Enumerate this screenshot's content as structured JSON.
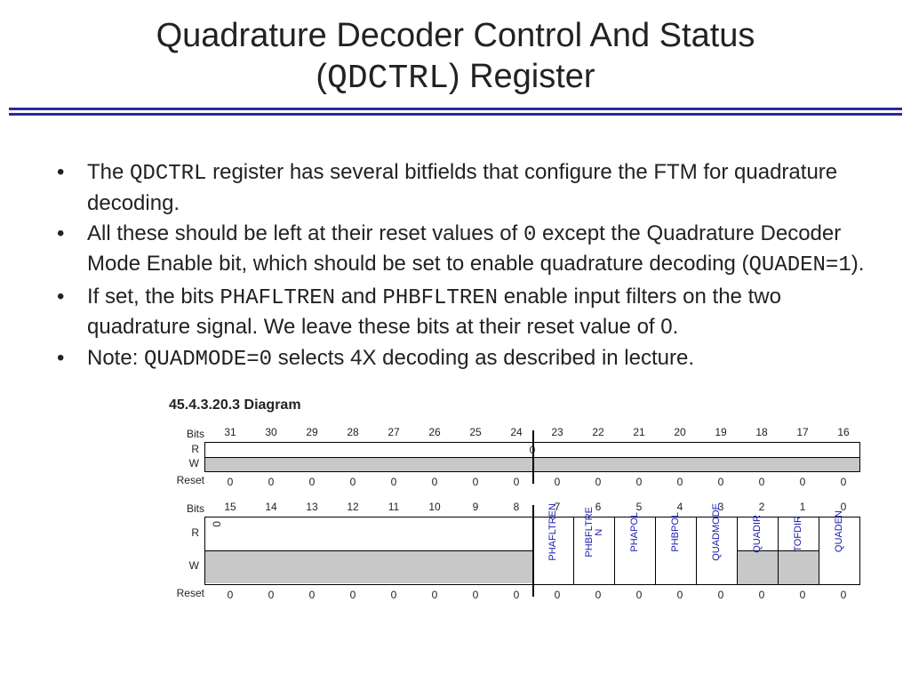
{
  "title": {
    "line1_pre": "Quadrature Decoder Control And Status",
    "line2_pre": "(",
    "line2_mono": "QDCTRL",
    "line2_post": ") Register"
  },
  "bullets": [
    {
      "parts": [
        {
          "t": "text",
          "v": "The "
        },
        {
          "t": "mono",
          "v": "QDCTRL"
        },
        {
          "t": "text",
          "v": " register has several bitfields that configure the FTM for quadrature decoding."
        }
      ]
    },
    {
      "parts": [
        {
          "t": "text",
          "v": "All these should be left at their reset values of "
        },
        {
          "t": "mono",
          "v": "0"
        },
        {
          "t": "text",
          "v": " except the Quadrature Decoder Mode Enable bit, which should be set to enable quadrature decoding ("
        },
        {
          "t": "mono",
          "v": "QUADEN=1"
        },
        {
          "t": "text",
          "v": ")."
        }
      ]
    },
    {
      "parts": [
        {
          "t": "text",
          "v": "If set, the bits "
        },
        {
          "t": "mono",
          "v": "PHAFLTREN"
        },
        {
          "t": "text",
          "v": " and "
        },
        {
          "t": "mono",
          "v": "PHBFLTREN"
        },
        {
          "t": "text",
          "v": " enable input filters on the two quadrature signal. We leave these bits at their reset value of 0."
        }
      ]
    },
    {
      "parts": [
        {
          "t": "text",
          "v": "Note: "
        },
        {
          "t": "mono",
          "v": "QUADMODE=0"
        },
        {
          "t": "text",
          "v": "  selects 4X decoding as described in lecture."
        }
      ]
    }
  ],
  "diagram": {
    "heading": "45.4.3.20.3   Diagram",
    "labels": {
      "bits": "Bits",
      "r": "R",
      "w": "W",
      "reset": "Reset"
    },
    "upper": {
      "bits": [
        "31",
        "30",
        "29",
        "28",
        "27",
        "26",
        "25",
        "24",
        "23",
        "22",
        "21",
        "20",
        "19",
        "18",
        "17",
        "16"
      ],
      "r_text": "0",
      "reset": [
        "0",
        "0",
        "0",
        "0",
        "0",
        "0",
        "0",
        "0",
        "0",
        "0",
        "0",
        "0",
        "0",
        "0",
        "0",
        "0"
      ]
    },
    "lower": {
      "bits": [
        "15",
        "14",
        "13",
        "12",
        "11",
        "10",
        "9",
        "8",
        "7",
        "6",
        "5",
        "4",
        "3",
        "2",
        "1",
        "0"
      ],
      "reserved_zero": "0",
      "fields": [
        {
          "name": "PHAFLTREN",
          "rw": "rw"
        },
        {
          "name": "PHBFLTRE\nN",
          "rw": "rw"
        },
        {
          "name": "PHAPOL",
          "rw": "rw"
        },
        {
          "name": "PHBPOL",
          "rw": "rw"
        },
        {
          "name": "QUADMODE",
          "rw": "rw"
        },
        {
          "name": "QUADIR",
          "rw": "ro"
        },
        {
          "name": "TOFDIR",
          "rw": "ro"
        },
        {
          "name": "QUADEN",
          "rw": "rw"
        }
      ],
      "reset": [
        "0",
        "0",
        "0",
        "0",
        "0",
        "0",
        "0",
        "0",
        "0",
        "0",
        "0",
        "0",
        "0",
        "0",
        "0",
        "0"
      ]
    }
  }
}
